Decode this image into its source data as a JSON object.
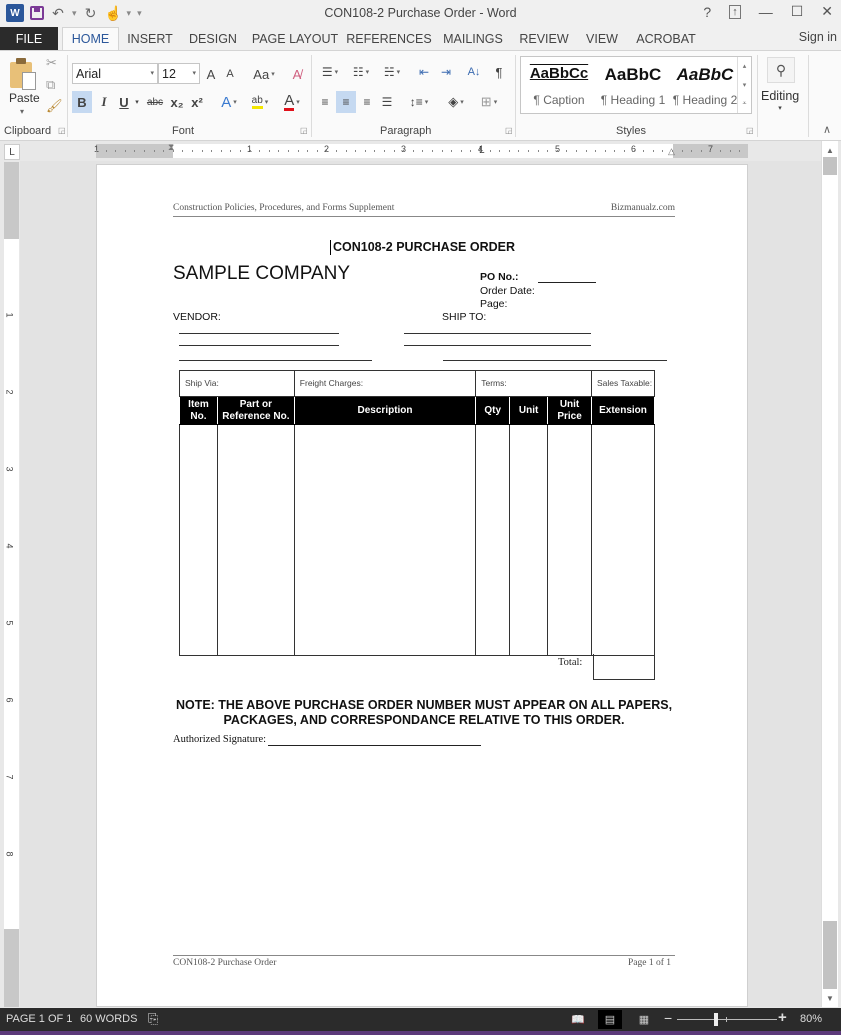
{
  "window": {
    "title": "CON108-2 Purchase Order - Word",
    "controls": [
      "?",
      "ribbon-display",
      "minimize",
      "maximize",
      "close"
    ]
  },
  "quick_access": {
    "app_icon": "W",
    "undo_glyph": "↶",
    "redo_glyph": "↻",
    "touch_glyph": "☝",
    "customize_glyph": "▾"
  },
  "tabs": {
    "file": "FILE",
    "items": [
      "HOME",
      "INSERT",
      "DESIGN",
      "PAGE LAYOUT",
      "REFERENCES",
      "MAILINGS",
      "REVIEW",
      "VIEW",
      "ACROBAT"
    ],
    "active": "HOME",
    "sign_in": "Sign in"
  },
  "ribbon": {
    "clipboard": {
      "paste_label": "Paste",
      "group_label": "Clipboard"
    },
    "font": {
      "font_name": "Arial",
      "font_size": "12",
      "grow_label": "A",
      "shrink_label": "A",
      "case_label": "Aa",
      "bold": "B",
      "italic": "I",
      "underline": "U",
      "strike": "abc",
      "subscript": "x₂",
      "superscript": "x²",
      "text_effects": "A",
      "highlight": "ab",
      "font_color": "A",
      "group_label": "Font"
    },
    "paragraph": {
      "pilcrow": "¶",
      "sort": "A↓",
      "group_label": "Paragraph"
    },
    "styles": {
      "items": [
        {
          "sample": "AaBbCc",
          "name": "¶ Caption"
        },
        {
          "sample": "AaBbC",
          "name": "¶ Heading 1"
        },
        {
          "sample": "AaBbC",
          "name": "¶ Heading 2"
        }
      ],
      "group_label": "Styles"
    },
    "editing": {
      "label": "Editing"
    }
  },
  "ruler": {
    "h_numbers": [
      "1",
      "1",
      "2",
      "3",
      "4",
      "5",
      "6",
      "7"
    ],
    "v_numbers": [
      "1",
      "2",
      "3",
      "4",
      "5",
      "6",
      "7",
      "8"
    ]
  },
  "document": {
    "header_left": "Construction Policies, Procedures, and Forms Supplement",
    "header_right": "Bizmanualz.com",
    "title": "CON108-2 PURCHASE ORDER",
    "company": "SAMPLE COMPANY",
    "po_no_label": "PO No.:",
    "order_date_label": "Order Date:",
    "page_label": "Page:",
    "vendor_label": "VENDOR:",
    "ship_to_label": "SHIP TO:",
    "table": {
      "info_row": [
        "Ship Via:",
        "Freight Charges:",
        "Terms:",
        "Sales Taxable:"
      ],
      "headers": [
        "Item No.",
        "Part or Reference No.",
        "Description",
        "Qty",
        "Unit",
        "Unit Price",
        "Extension"
      ],
      "rows": []
    },
    "total_label": "Total:",
    "note": "NOTE: THE ABOVE PURCHASE ORDER NUMBER MUST APPEAR ON ALL PAPERS, PACKAGES, AND CORRESPONDANCE RELATIVE TO THIS ORDER.",
    "signature_label": "Authorized Signature:",
    "footer_left": "CON108-2 Purchase Order",
    "footer_right": "Page 1 of 1"
  },
  "status": {
    "page": "PAGE 1 OF 1",
    "words": "60 WORDS",
    "zoom": "80%",
    "zoom_percent": 80
  },
  "colors": {
    "word_blue": "#2b579a",
    "status_bar": "#2b2b2b",
    "accent_purple": "#5c3a7a",
    "table_header_bg": "#000000"
  }
}
